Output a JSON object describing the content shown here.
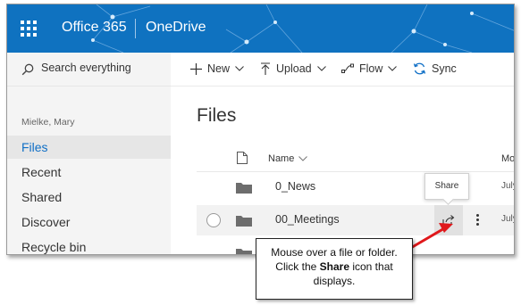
{
  "topbar": {
    "app_office": "Office 365",
    "app_onedrive": "OneDrive",
    "accent": "#0f72c0"
  },
  "sidebar": {
    "search_label": "Search everything",
    "user_name": "Mielke, Mary",
    "items": [
      {
        "label": "Files",
        "active": true
      },
      {
        "label": "Recent"
      },
      {
        "label": "Shared"
      },
      {
        "label": "Discover"
      },
      {
        "label": "Recycle bin"
      }
    ]
  },
  "commands": {
    "new": "New",
    "upload": "Upload",
    "flow": "Flow",
    "sync": "Sync"
  },
  "main": {
    "title": "Files",
    "columns": {
      "name": "Name",
      "modified": "Mo"
    },
    "rows": [
      {
        "name": "0_News",
        "modified": "July"
      },
      {
        "name": "00_Meetings",
        "modified": "July"
      },
      {
        "name": "",
        "modified": ""
      }
    ],
    "tooltip": "Share"
  },
  "callout": {
    "line1": "Mouse over a file or folder.",
    "line2_pre": "Click the ",
    "line2_bold": "Share",
    "line2_post": " icon that",
    "line3": "displays."
  },
  "colors": {
    "accent_blue": "#0f6fc6",
    "arrow_red": "#e0181b"
  }
}
